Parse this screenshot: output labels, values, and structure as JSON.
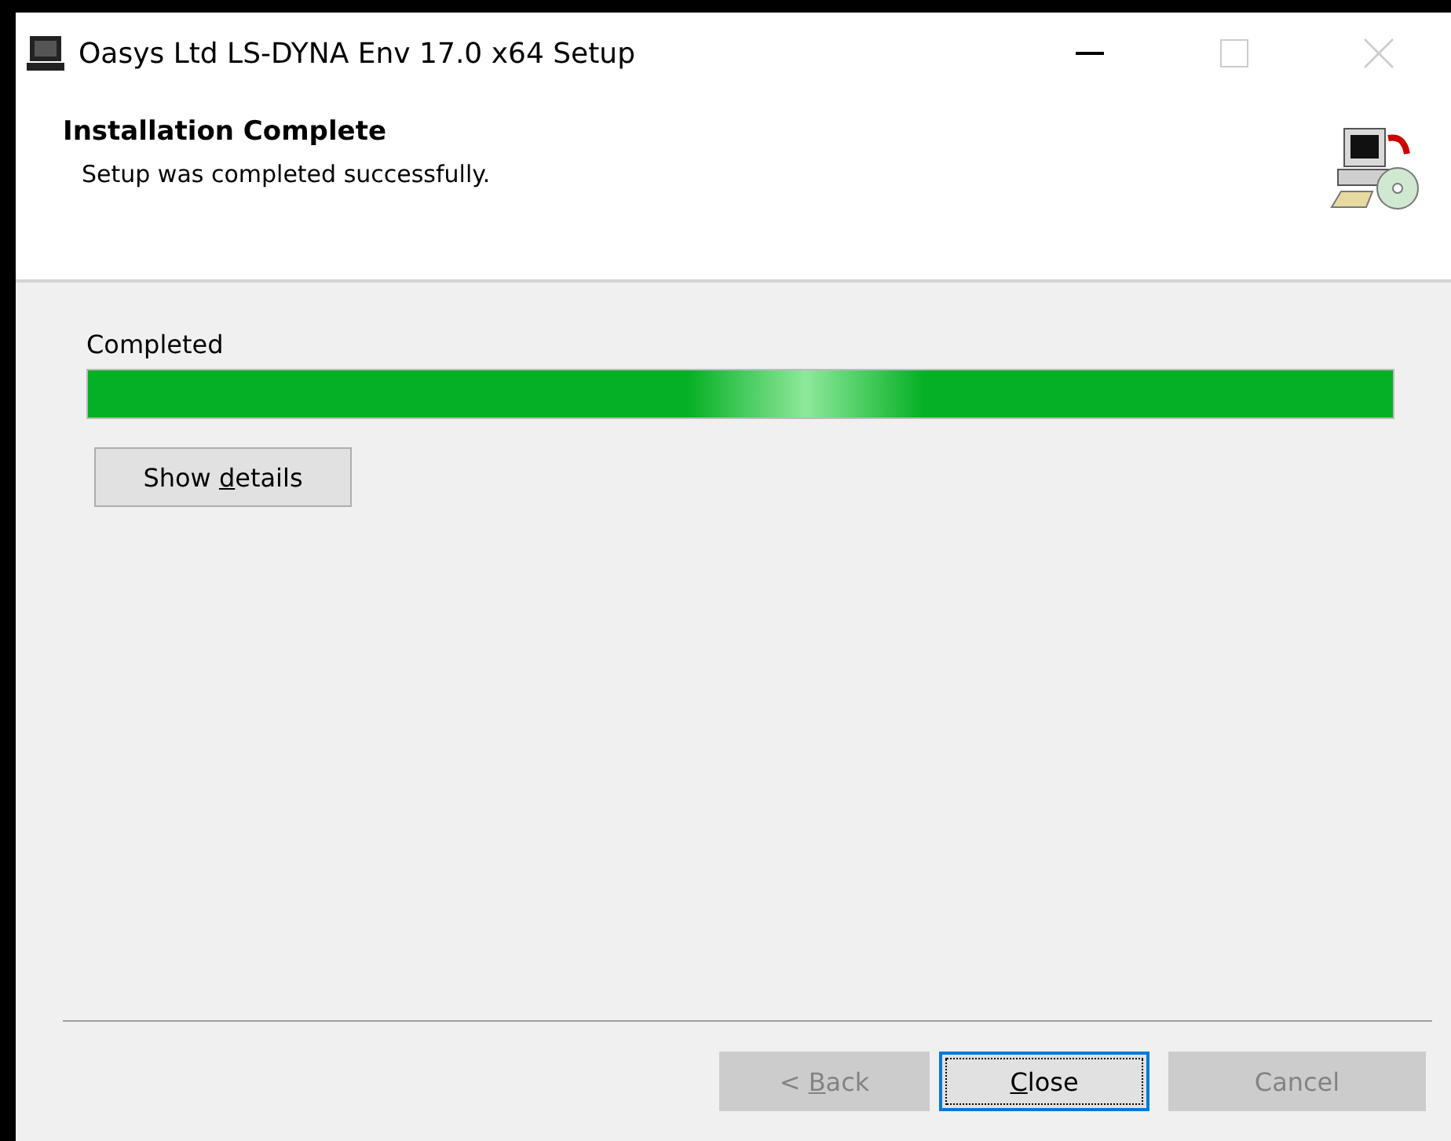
{
  "window": {
    "title": "Oasys Ltd LS-DYNA Env 17.0 x64 Setup"
  },
  "header": {
    "title": "Installation Complete",
    "subtitle": "Setup was completed successfully."
  },
  "progress": {
    "label": "Completed",
    "level": 1
  },
  "details_button": {
    "before": "Show ",
    "accelerator": "d",
    "after": "etails",
    "disabled": false,
    "focused": false
  },
  "buttons": [
    {
      "before": "< ",
      "accelerator": "B",
      "after": "ack",
      "disabled": true,
      "focused": false
    },
    {
      "accelerator": "C",
      "after": "lose",
      "disabled": false,
      "focused": true
    },
    {
      "after": "Cancel",
      "disabled": true,
      "focused": false
    }
  ]
}
